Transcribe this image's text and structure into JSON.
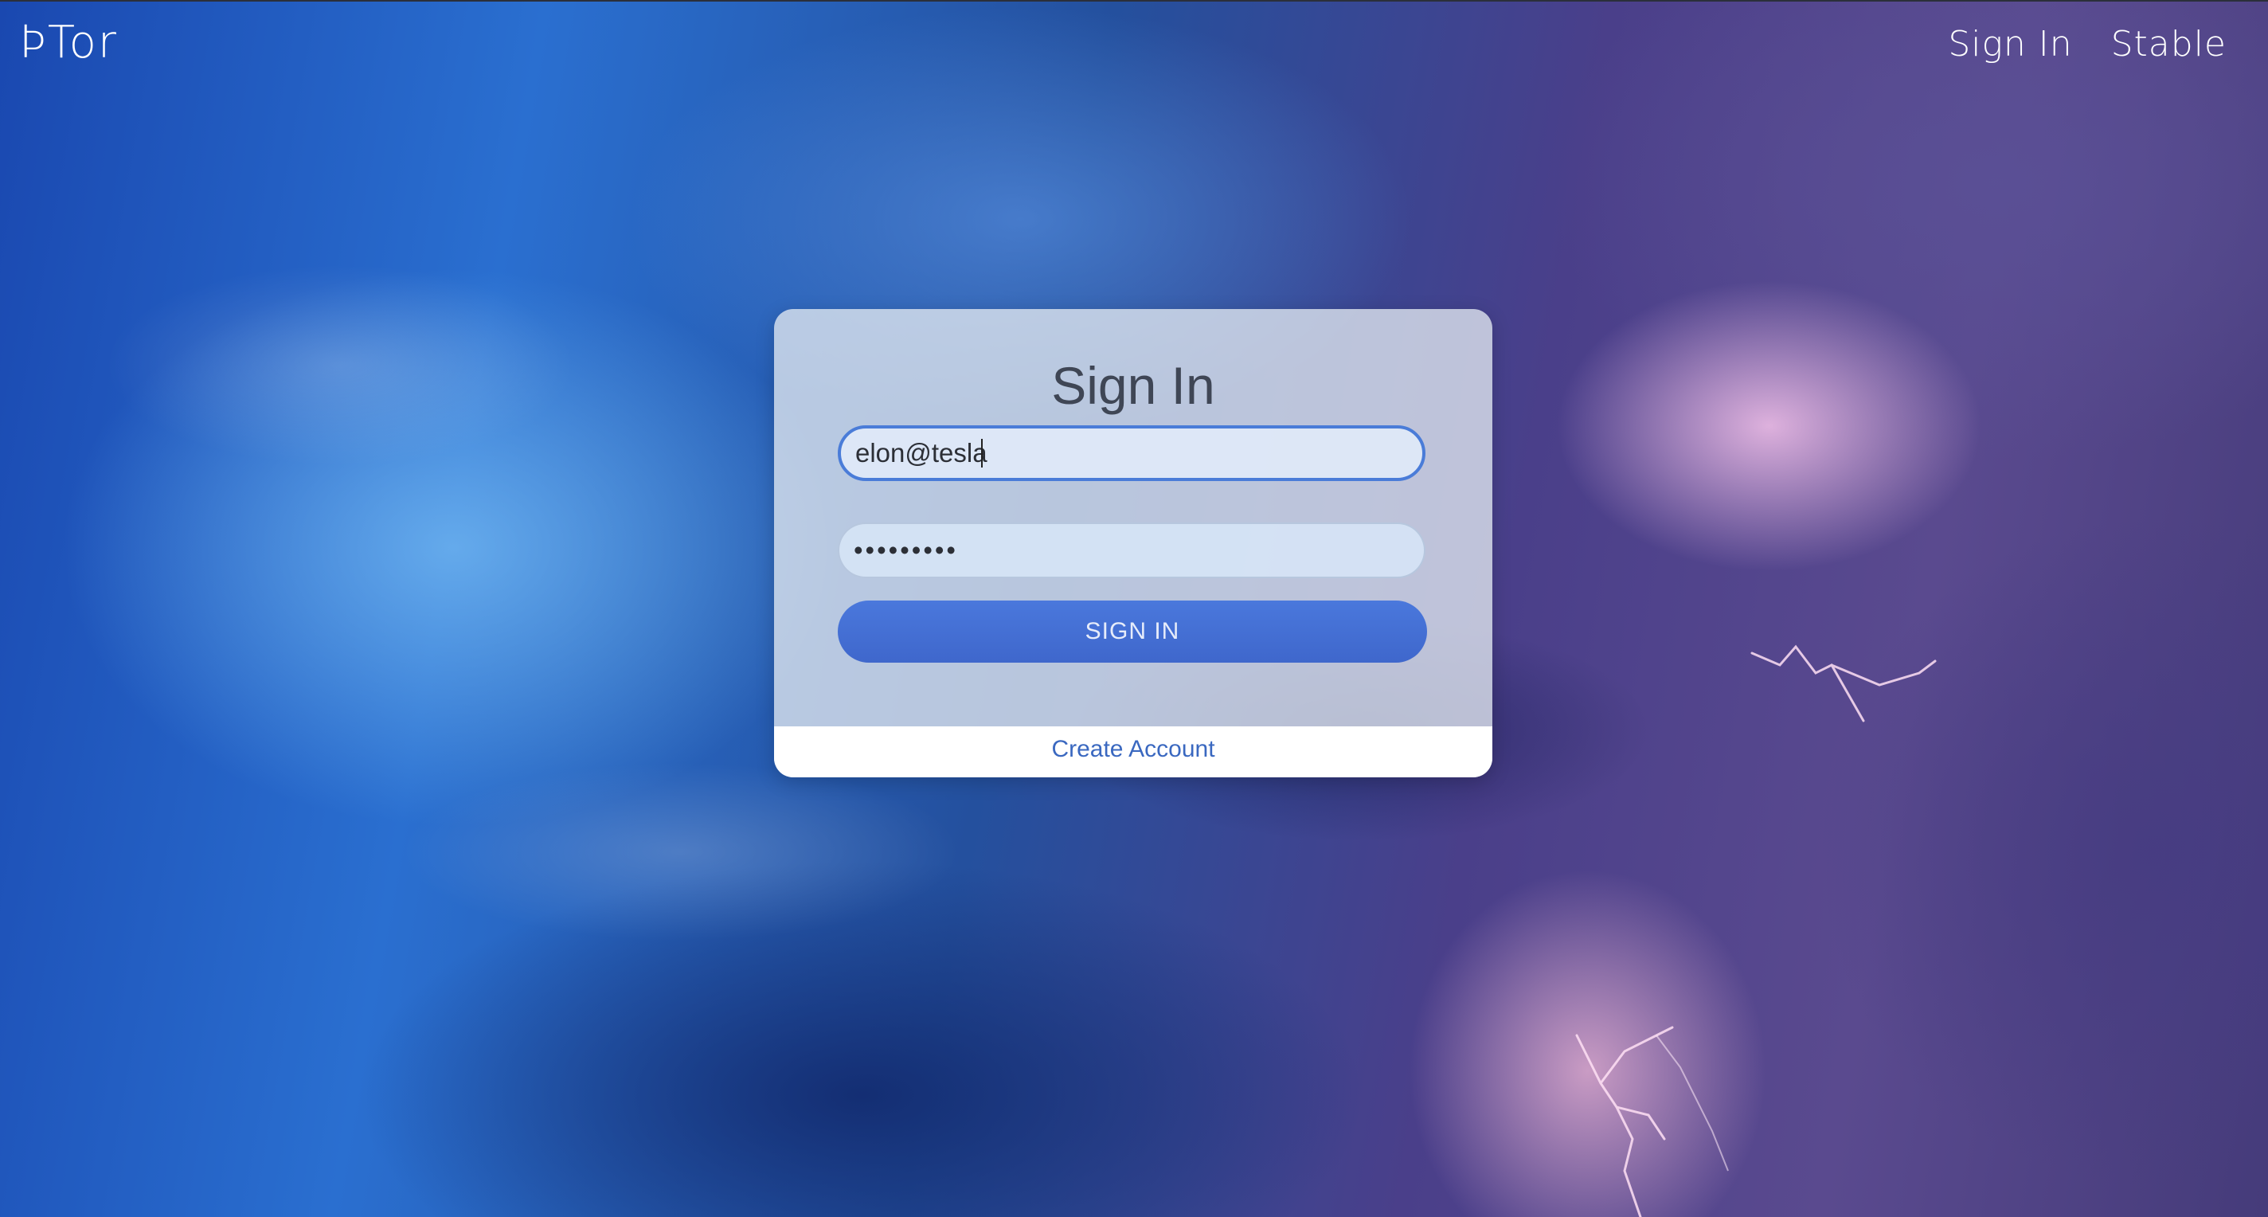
{
  "header": {
    "brand": "ÞTor",
    "nav": [
      {
        "label": "Sign In"
      },
      {
        "label": "Stable"
      }
    ]
  },
  "signin_card": {
    "title": "Sign In",
    "email_value": "elon@tesla",
    "password_value": "•••••••••",
    "submit_label": "SIGN IN",
    "create_account_label": "Create Account"
  },
  "colors": {
    "accent": "#4a78dc",
    "link": "#3a68c0"
  }
}
